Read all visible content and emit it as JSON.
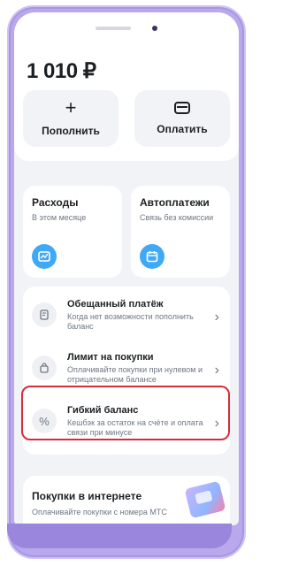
{
  "balance": {
    "amount": "1 010 ₽"
  },
  "actions": {
    "topup_label": "Пополнить",
    "topup_icon": "plus-icon",
    "pay_label": "Оплатить",
    "pay_icon": "wallet-icon"
  },
  "tiles": [
    {
      "title": "Расходы",
      "subtitle": "В этом месяце",
      "icon": "chart-icon"
    },
    {
      "title": "Автоплатежи",
      "subtitle": "Связь без комиссии",
      "icon": "calendar-icon"
    }
  ],
  "services": [
    {
      "title": "Обещанный платёж",
      "subtitle": "Когда нет возможности пополнить баланс",
      "icon": "document-icon"
    },
    {
      "title": "Лимит на покупки",
      "subtitle": "Оплачивайте покупки при нулевом и отрицательном балансе",
      "icon": "shopping-bag-icon"
    },
    {
      "title": "Гибкий баланс",
      "subtitle": "Кешбэк за остаток на счёте и оплата связи при минусе",
      "icon": "percent-icon"
    }
  ],
  "promo": {
    "title": "Покупки в интернете",
    "subtitle": "Оплачивайте покупки с номера МТС"
  },
  "colors": {
    "accent_blue": "#3fa9f5",
    "highlight_red": "#d92b3a",
    "frame_purple": "#b9a8eb"
  }
}
